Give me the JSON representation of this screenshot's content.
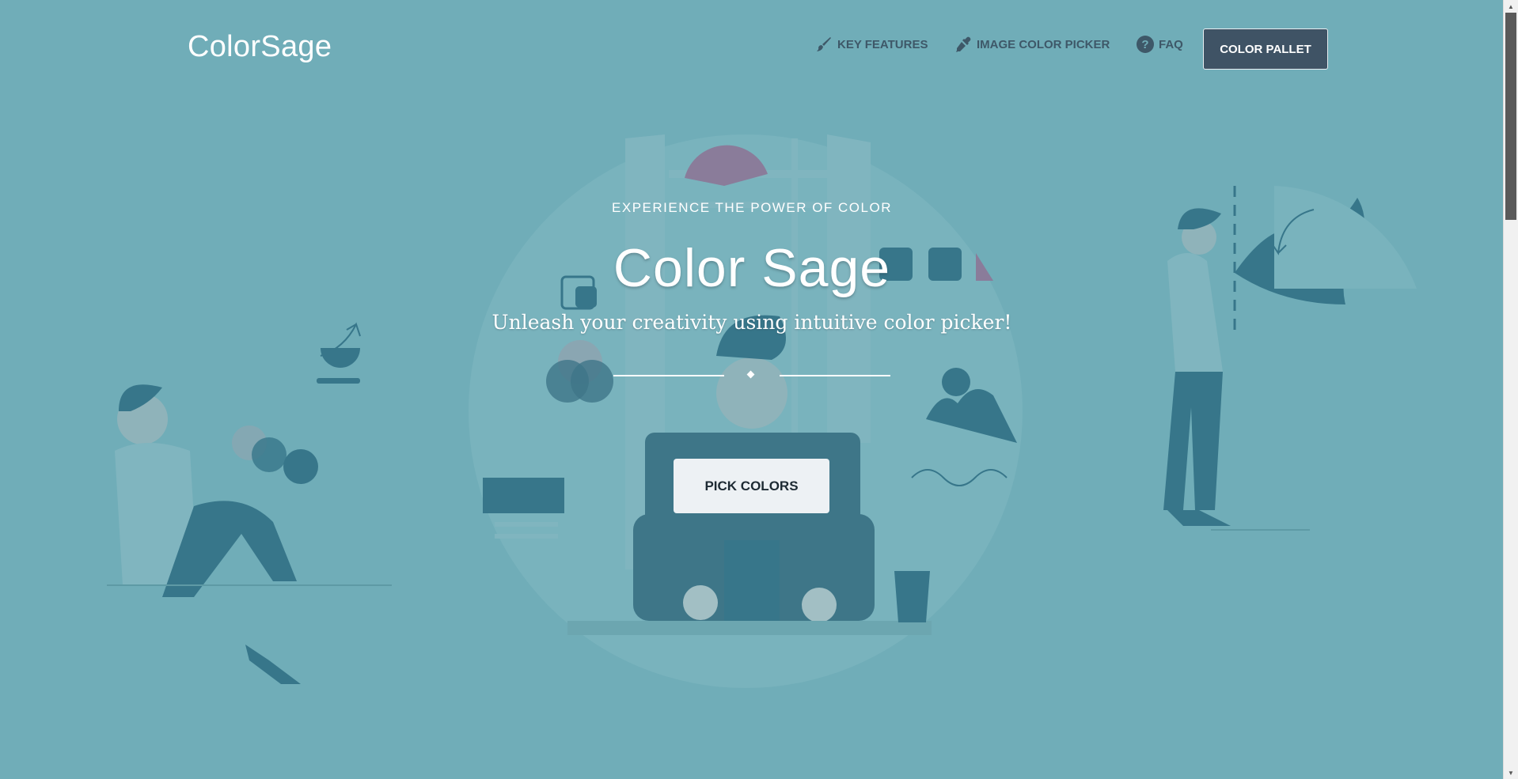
{
  "nav": {
    "logo": "ColorSage",
    "items": [
      {
        "label": "KEY FEATURES",
        "icon": "brush-icon"
      },
      {
        "label": "IMAGE COLOR PICKER",
        "icon": "eyedropper-icon"
      },
      {
        "label": "FAQ",
        "icon": "question-icon"
      }
    ],
    "cta_label": "COLOR PALLET"
  },
  "hero": {
    "eyebrow": "EXPERIENCE THE POWER OF COLOR",
    "title": "Color Sage",
    "subtitle": "Unleash your creativity using intuitive color picker!",
    "button_label": "PICK COLORS"
  },
  "colors": {
    "background": "#70adb8",
    "illustration_dark": "#37768a",
    "illustration_light": "#80b5bf",
    "accent_mauve": "#8a7c9a",
    "button_dark": "#3f5365",
    "button_light": "#edf1f4"
  }
}
